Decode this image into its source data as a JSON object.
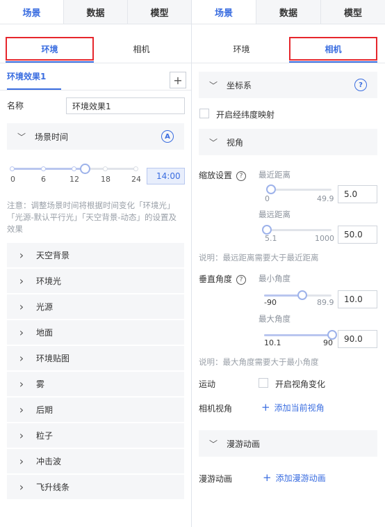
{
  "tabs": [
    "场景",
    "数据",
    "模型"
  ],
  "left": {
    "subtabs": {
      "env": "环境",
      "camera": "相机"
    },
    "env_tab": "环境效果1",
    "plus": "+",
    "name_label": "名称",
    "name_value": "环境效果1",
    "scene_time": {
      "title": "场景时间",
      "icon": "A",
      "ticks": [
        "0",
        "6",
        "12",
        "18",
        "24"
      ],
      "value": "14:00",
      "note": "注意：调整场景时间将根据时间变化「环境光」「光源-默认平行光」「天空背景-动态」的设置及效果"
    },
    "sections": [
      "天空背景",
      "环境光",
      "光源",
      "地面",
      "环境贴图",
      "雾",
      "后期",
      "粒子",
      "冲击波",
      "飞升线条"
    ]
  },
  "right": {
    "subtabs": {
      "env": "环境",
      "camera": "相机"
    },
    "coord": {
      "title": "坐标系",
      "icon": "?"
    },
    "latlng_label": "开启经纬度映射",
    "view": {
      "title": "视角"
    },
    "zoom": {
      "label": "缩放设置",
      "near_label": "最近距离",
      "near_min": "0",
      "near_max": "49.9",
      "near_value": "5.0",
      "near_fraction": 0.1,
      "far_label": "最远距离",
      "far_min": "5.1",
      "far_max": "1000",
      "far_value": "50.0",
      "far_fraction": 0.045,
      "note": "说明：最远距离需要大于最近距离"
    },
    "pitch": {
      "label": "垂直角度",
      "min_label": "最小角度",
      "min_min": "-90",
      "min_max": "89.9",
      "min_value": "10.0",
      "min_fraction": 0.555,
      "max_label": "最大角度",
      "max_min": "10.1",
      "max_max": "90",
      "max_value": "90.0",
      "max_fraction": 1.0,
      "note": "说明：最大角度需要大于最小角度"
    },
    "motion": {
      "label": "运动",
      "checkbox_label": "开启视角变化"
    },
    "camview": {
      "label": "相机视角",
      "link": "添加当前视角"
    },
    "tour": {
      "title": "漫游动画",
      "label": "漫游动画",
      "link": "添加漫游动画"
    }
  }
}
